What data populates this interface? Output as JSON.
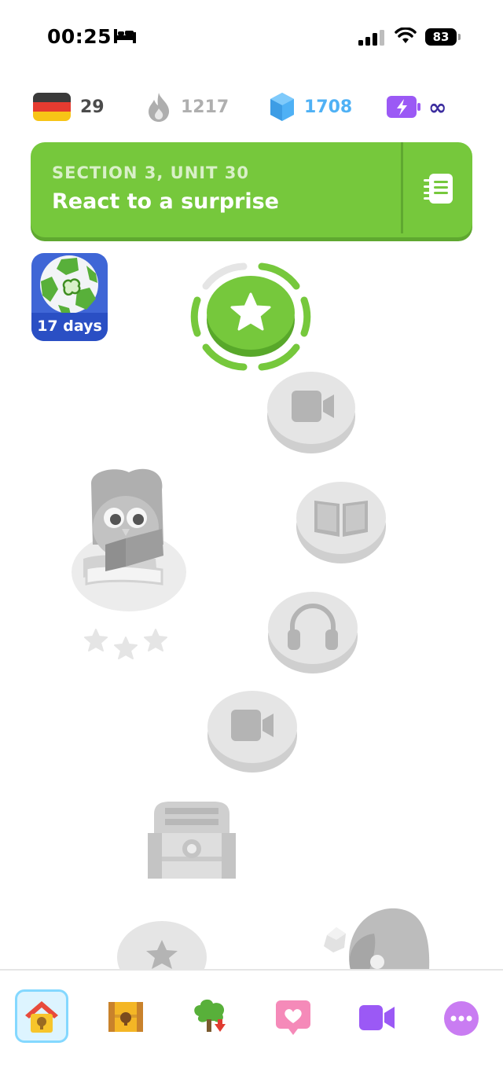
{
  "status_bar": {
    "time": "00:25",
    "battery": "83"
  },
  "stats": {
    "language_flag": "german-flag-icon",
    "language_count": "29",
    "streak": "1217",
    "gems": "1708",
    "energy": "∞"
  },
  "unit": {
    "section": "SECTION 3, UNIT 30",
    "title": "React to a surprise"
  },
  "streak_badge": {
    "label": "17 days"
  },
  "path": [
    {
      "type": "star",
      "state": "current"
    },
    {
      "type": "video",
      "state": "locked"
    },
    {
      "type": "book",
      "state": "locked"
    },
    {
      "type": "headphones",
      "state": "locked"
    },
    {
      "type": "video",
      "state": "locked"
    },
    {
      "type": "chest",
      "state": "locked"
    },
    {
      "type": "star",
      "state": "locked"
    }
  ],
  "nav": [
    {
      "id": "home",
      "icon": "home-icon",
      "active": true
    },
    {
      "id": "chest",
      "icon": "treasure-chest-icon",
      "active": false
    },
    {
      "id": "tree",
      "icon": "download-tree-icon",
      "active": false
    },
    {
      "id": "hearts",
      "icon": "heart-icon",
      "active": false
    },
    {
      "id": "video",
      "icon": "video-call-icon",
      "active": false
    },
    {
      "id": "more",
      "icon": "more-icon",
      "active": false
    }
  ],
  "colors": {
    "green": "#76c83c",
    "green_dark": "#5fa830",
    "gem_blue": "#4fb1f5",
    "energy_purple": "#9b59f5",
    "locked_gray": "#e5e5e5"
  }
}
